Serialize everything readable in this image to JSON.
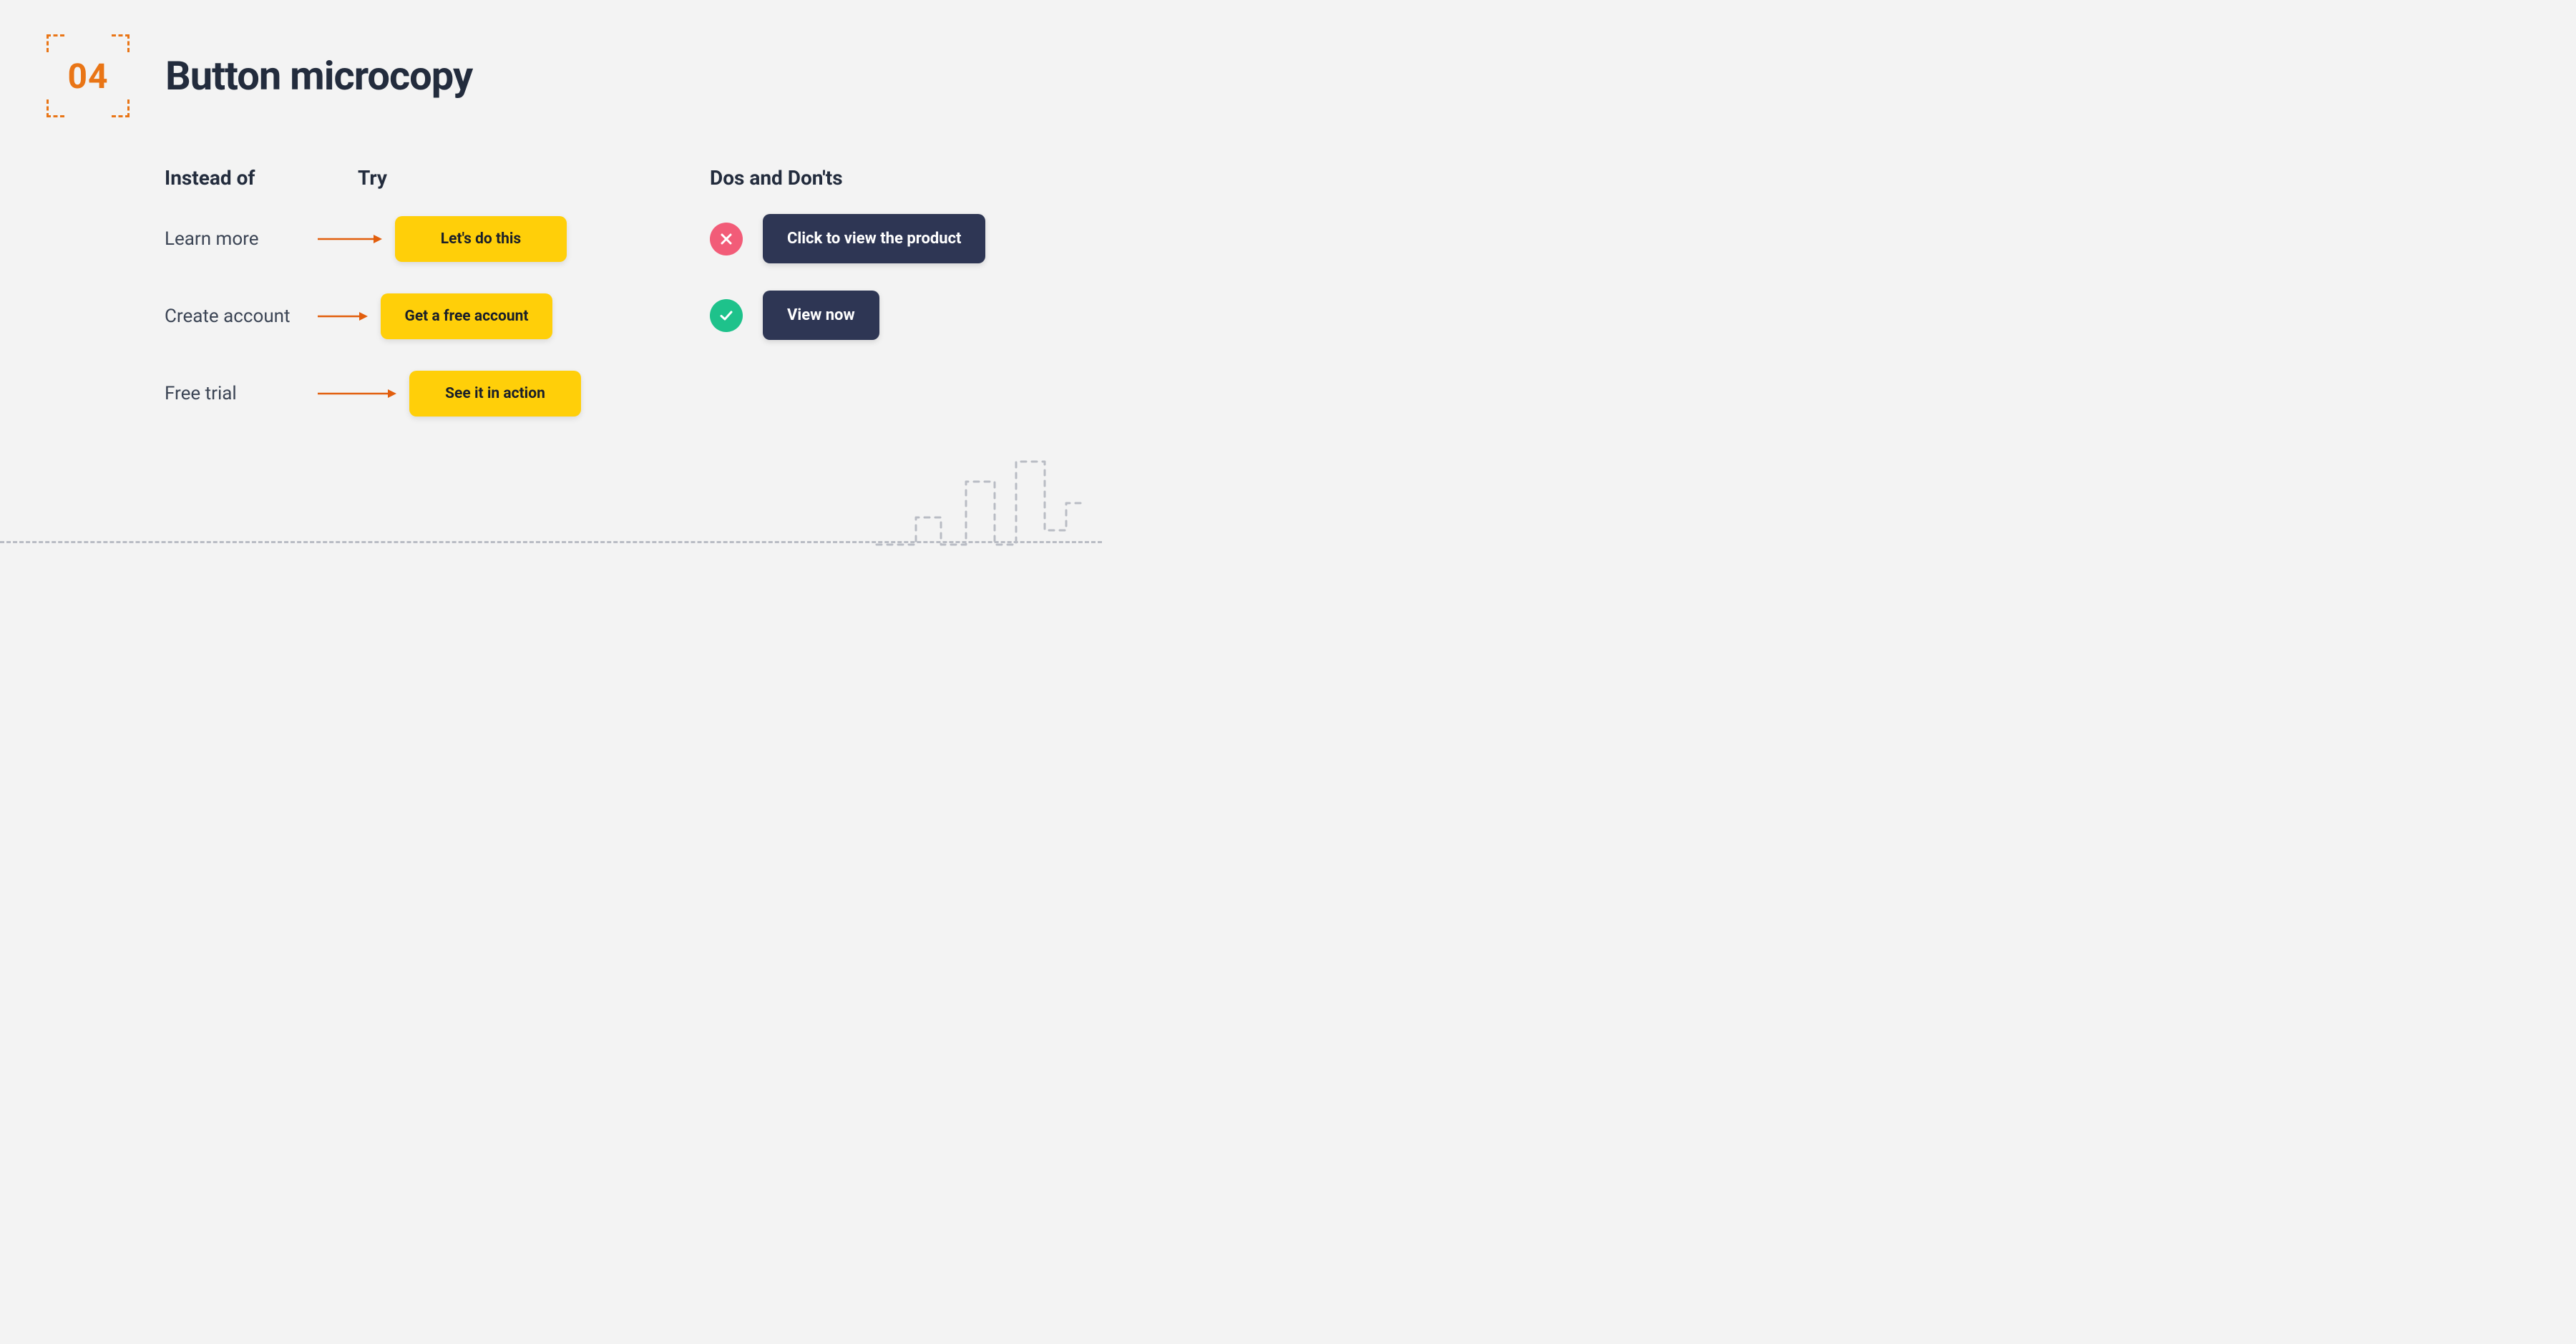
{
  "slide": {
    "number": "04",
    "title": "Button microcopy"
  },
  "columns": {
    "instead_of": "Instead of",
    "try": "Try",
    "dos_donts": "Dos and Don'ts"
  },
  "pairs": [
    {
      "instead": "Learn more",
      "try": "Let's do this"
    },
    {
      "instead": "Create account",
      "try": "Get a free account"
    },
    {
      "instead": "Free trial",
      "try": "See it in action"
    }
  ],
  "dos_donts": {
    "bad": "Click to view the product",
    "good": "View now"
  },
  "colors": {
    "accent_orange": "#e97516",
    "button_yellow": "#ffcf09",
    "button_navy": "#2e3654",
    "status_bad": "#f25c78",
    "status_good": "#1ec28b"
  }
}
